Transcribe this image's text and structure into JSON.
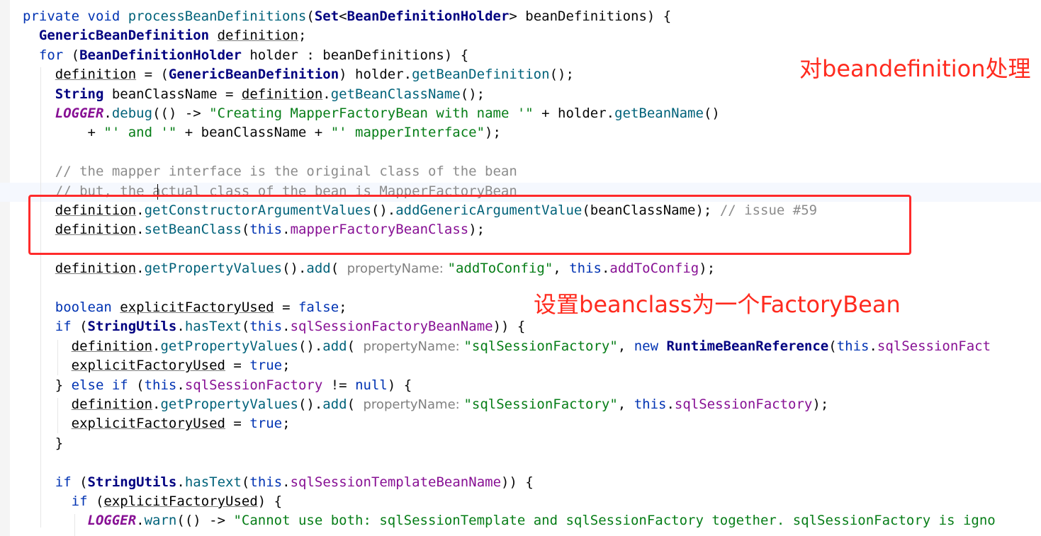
{
  "code_lines": [
    [
      {
        "t": "private ",
        "c": "kw"
      },
      {
        "t": "void ",
        "c": "kw"
      },
      {
        "t": "processBeanDefinitions",
        "c": "fn"
      },
      {
        "t": "(",
        "c": "op"
      },
      {
        "t": "Set",
        "c": "ty"
      },
      {
        "t": "<",
        "c": "op"
      },
      {
        "t": "BeanDefinitionHolder",
        "c": "ty"
      },
      {
        "t": "> ",
        "c": "op"
      },
      {
        "t": "beanDefinitions",
        "c": "plain"
      },
      {
        "t": ") {",
        "c": "op"
      }
    ],
    [
      {
        "t": "  ",
        "c": "plain"
      },
      {
        "t": "GenericBeanDefinition",
        "c": "ty"
      },
      {
        "t": " ",
        "c": "plain"
      },
      {
        "t": "definition",
        "c": "var"
      },
      {
        "t": ";",
        "c": "op"
      }
    ],
    [
      {
        "t": "  ",
        "c": "plain"
      },
      {
        "t": "for ",
        "c": "kw"
      },
      {
        "t": "(",
        "c": "op"
      },
      {
        "t": "BeanDefinitionHolder",
        "c": "ty"
      },
      {
        "t": " holder : ",
        "c": "plain"
      },
      {
        "t": "beanDefinitions",
        "c": "plain"
      },
      {
        "t": ") {",
        "c": "op"
      }
    ],
    [
      {
        "t": "    ",
        "c": "plain"
      },
      {
        "t": "definition",
        "c": "var"
      },
      {
        "t": " = (",
        "c": "op"
      },
      {
        "t": "GenericBeanDefinition",
        "c": "ty"
      },
      {
        "t": ") holder.",
        "c": "plain"
      },
      {
        "t": "getBeanDefinition",
        "c": "fn"
      },
      {
        "t": "();",
        "c": "op"
      }
    ],
    [
      {
        "t": "    ",
        "c": "plain"
      },
      {
        "t": "String",
        "c": "ty"
      },
      {
        "t": " beanClassName = ",
        "c": "plain"
      },
      {
        "t": "definition",
        "c": "var"
      },
      {
        "t": ".",
        "c": "op"
      },
      {
        "t": "getBeanClassName",
        "c": "fn"
      },
      {
        "t": "();",
        "c": "op"
      }
    ],
    [
      {
        "t": "    ",
        "c": "plain"
      },
      {
        "t": "LOGGER",
        "c": "static"
      },
      {
        "t": ".",
        "c": "op"
      },
      {
        "t": "debug",
        "c": "fn"
      },
      {
        "t": "(() -> ",
        "c": "op"
      },
      {
        "t": "\"Creating MapperFactoryBean with name '\"",
        "c": "str"
      },
      {
        "t": " + holder.",
        "c": "plain"
      },
      {
        "t": "getBeanName",
        "c": "fn"
      },
      {
        "t": "()",
        "c": "op"
      }
    ],
    [
      {
        "t": "        + ",
        "c": "plain"
      },
      {
        "t": "\"' and '\"",
        "c": "str"
      },
      {
        "t": " + beanClassName + ",
        "c": "plain"
      },
      {
        "t": "\"' mapperInterface\"",
        "c": "str"
      },
      {
        "t": ");",
        "c": "op"
      }
    ],
    [],
    [
      {
        "t": "    ",
        "c": "plain"
      },
      {
        "t": "// the mapper interface is the original class of the bean",
        "c": "cmt"
      }
    ],
    [
      {
        "t": "    ",
        "c": "plain"
      },
      {
        "t": "// but, the actual class of the bean is MapperFactoryBean",
        "c": "cmt"
      }
    ],
    [
      {
        "t": "    ",
        "c": "plain"
      },
      {
        "t": "definition",
        "c": "var"
      },
      {
        "t": ".",
        "c": "op"
      },
      {
        "t": "getConstructorArgumentValues",
        "c": "fn"
      },
      {
        "t": "().",
        "c": "op"
      },
      {
        "t": "addGenericArgumentValue",
        "c": "fn"
      },
      {
        "t": "(beanClassName); ",
        "c": "plain"
      },
      {
        "t": "// issue #59",
        "c": "cmt"
      }
    ],
    [
      {
        "t": "    ",
        "c": "plain"
      },
      {
        "t": "definition",
        "c": "var"
      },
      {
        "t": ".",
        "c": "op"
      },
      {
        "t": "setBeanClass",
        "c": "fn"
      },
      {
        "t": "(",
        "c": "op"
      },
      {
        "t": "this",
        "c": "kw"
      },
      {
        "t": ".",
        "c": "op"
      },
      {
        "t": "mapperFactoryBeanClass",
        "c": "field"
      },
      {
        "t": ");",
        "c": "op"
      }
    ],
    [],
    [
      {
        "t": "    ",
        "c": "plain"
      },
      {
        "t": "definition",
        "c": "var"
      },
      {
        "t": ".",
        "c": "op"
      },
      {
        "t": "getPropertyValues",
        "c": "fn"
      },
      {
        "t": "().",
        "c": "op"
      },
      {
        "t": "add",
        "c": "fn"
      },
      {
        "t": "( ",
        "c": "op"
      },
      {
        "t": "propertyName: ",
        "c": "hint"
      },
      {
        "t": "\"addToConfig\"",
        "c": "str"
      },
      {
        "t": ", ",
        "c": "op"
      },
      {
        "t": "this",
        "c": "kw"
      },
      {
        "t": ".",
        "c": "op"
      },
      {
        "t": "addToConfig",
        "c": "field"
      },
      {
        "t": ");",
        "c": "op"
      }
    ],
    [],
    [
      {
        "t": "    ",
        "c": "plain"
      },
      {
        "t": "boolean ",
        "c": "kw"
      },
      {
        "t": "explicitFactoryUsed",
        "c": "var"
      },
      {
        "t": " = ",
        "c": "op"
      },
      {
        "t": "false",
        "c": "kw"
      },
      {
        "t": ";",
        "c": "op"
      }
    ],
    [
      {
        "t": "    ",
        "c": "plain"
      },
      {
        "t": "if ",
        "c": "kw"
      },
      {
        "t": "(",
        "c": "op"
      },
      {
        "t": "StringUtils",
        "c": "ty"
      },
      {
        "t": ".",
        "c": "op"
      },
      {
        "t": "hasText",
        "c": "fn"
      },
      {
        "t": "(",
        "c": "op"
      },
      {
        "t": "this",
        "c": "kw"
      },
      {
        "t": ".",
        "c": "op"
      },
      {
        "t": "sqlSessionFactoryBeanName",
        "c": "field"
      },
      {
        "t": ")) {",
        "c": "op"
      }
    ],
    [
      {
        "t": "      ",
        "c": "plain"
      },
      {
        "t": "definition",
        "c": "var"
      },
      {
        "t": ".",
        "c": "op"
      },
      {
        "t": "getPropertyValues",
        "c": "fn"
      },
      {
        "t": "().",
        "c": "op"
      },
      {
        "t": "add",
        "c": "fn"
      },
      {
        "t": "( ",
        "c": "op"
      },
      {
        "t": "propertyName: ",
        "c": "hint"
      },
      {
        "t": "\"sqlSessionFactory\"",
        "c": "str"
      },
      {
        "t": ", ",
        "c": "op"
      },
      {
        "t": "new ",
        "c": "kw"
      },
      {
        "t": "RuntimeBeanReference",
        "c": "ty"
      },
      {
        "t": "(",
        "c": "op"
      },
      {
        "t": "this",
        "c": "kw"
      },
      {
        "t": ".",
        "c": "op"
      },
      {
        "t": "sqlSessionFact",
        "c": "field"
      }
    ],
    [
      {
        "t": "      ",
        "c": "plain"
      },
      {
        "t": "explicitFactoryUsed",
        "c": "var"
      },
      {
        "t": " = ",
        "c": "op"
      },
      {
        "t": "true",
        "c": "kw"
      },
      {
        "t": ";",
        "c": "op"
      }
    ],
    [
      {
        "t": "    } ",
        "c": "op"
      },
      {
        "t": "else if ",
        "c": "kw"
      },
      {
        "t": "(",
        "c": "op"
      },
      {
        "t": "this",
        "c": "kw"
      },
      {
        "t": ".",
        "c": "op"
      },
      {
        "t": "sqlSessionFactory",
        "c": "field"
      },
      {
        "t": " != ",
        "c": "op"
      },
      {
        "t": "null",
        "c": "kw"
      },
      {
        "t": ") {",
        "c": "op"
      }
    ],
    [
      {
        "t": "      ",
        "c": "plain"
      },
      {
        "t": "definition",
        "c": "var"
      },
      {
        "t": ".",
        "c": "op"
      },
      {
        "t": "getPropertyValues",
        "c": "fn"
      },
      {
        "t": "().",
        "c": "op"
      },
      {
        "t": "add",
        "c": "fn"
      },
      {
        "t": "( ",
        "c": "op"
      },
      {
        "t": "propertyName: ",
        "c": "hint"
      },
      {
        "t": "\"sqlSessionFactory\"",
        "c": "str"
      },
      {
        "t": ", ",
        "c": "op"
      },
      {
        "t": "this",
        "c": "kw"
      },
      {
        "t": ".",
        "c": "op"
      },
      {
        "t": "sqlSessionFactory",
        "c": "field"
      },
      {
        "t": ");",
        "c": "op"
      }
    ],
    [
      {
        "t": "      ",
        "c": "plain"
      },
      {
        "t": "explicitFactoryUsed",
        "c": "var"
      },
      {
        "t": " = ",
        "c": "op"
      },
      {
        "t": "true",
        "c": "kw"
      },
      {
        "t": ";",
        "c": "op"
      }
    ],
    [
      {
        "t": "    }",
        "c": "op"
      }
    ],
    [],
    [
      {
        "t": "    ",
        "c": "plain"
      },
      {
        "t": "if ",
        "c": "kw"
      },
      {
        "t": "(",
        "c": "op"
      },
      {
        "t": "StringUtils",
        "c": "ty"
      },
      {
        "t": ".",
        "c": "op"
      },
      {
        "t": "hasText",
        "c": "fn"
      },
      {
        "t": "(",
        "c": "op"
      },
      {
        "t": "this",
        "c": "kw"
      },
      {
        "t": ".",
        "c": "op"
      },
      {
        "t": "sqlSessionTemplateBeanName",
        "c": "field"
      },
      {
        "t": ")) {",
        "c": "op"
      }
    ],
    [
      {
        "t": "      ",
        "c": "plain"
      },
      {
        "t": "if ",
        "c": "kw"
      },
      {
        "t": "(",
        "c": "op"
      },
      {
        "t": "explicitFactoryUsed",
        "c": "var"
      },
      {
        "t": ") {",
        "c": "op"
      }
    ],
    [
      {
        "t": "        ",
        "c": "plain"
      },
      {
        "t": "LOGGER",
        "c": "static"
      },
      {
        "t": ".",
        "c": "op"
      },
      {
        "t": "warn",
        "c": "fn"
      },
      {
        "t": "(() -> ",
        "c": "op"
      },
      {
        "t": "\"Cannot use both: sqlSessionTemplate and sqlSessionFactory together. sqlSessionFactory is igno",
        "c": "str"
      }
    ]
  ],
  "annotations": {
    "note_1": "对beandefinition处理",
    "note_2": "设置beanclass为一个FactoryBean"
  },
  "colors": {
    "keyword": "#0033b3",
    "type": "#000080",
    "method": "#00627a",
    "string": "#067d17",
    "comment": "#8c8c8c",
    "field": "#871094",
    "annotation_red": "#ff2b1f"
  }
}
